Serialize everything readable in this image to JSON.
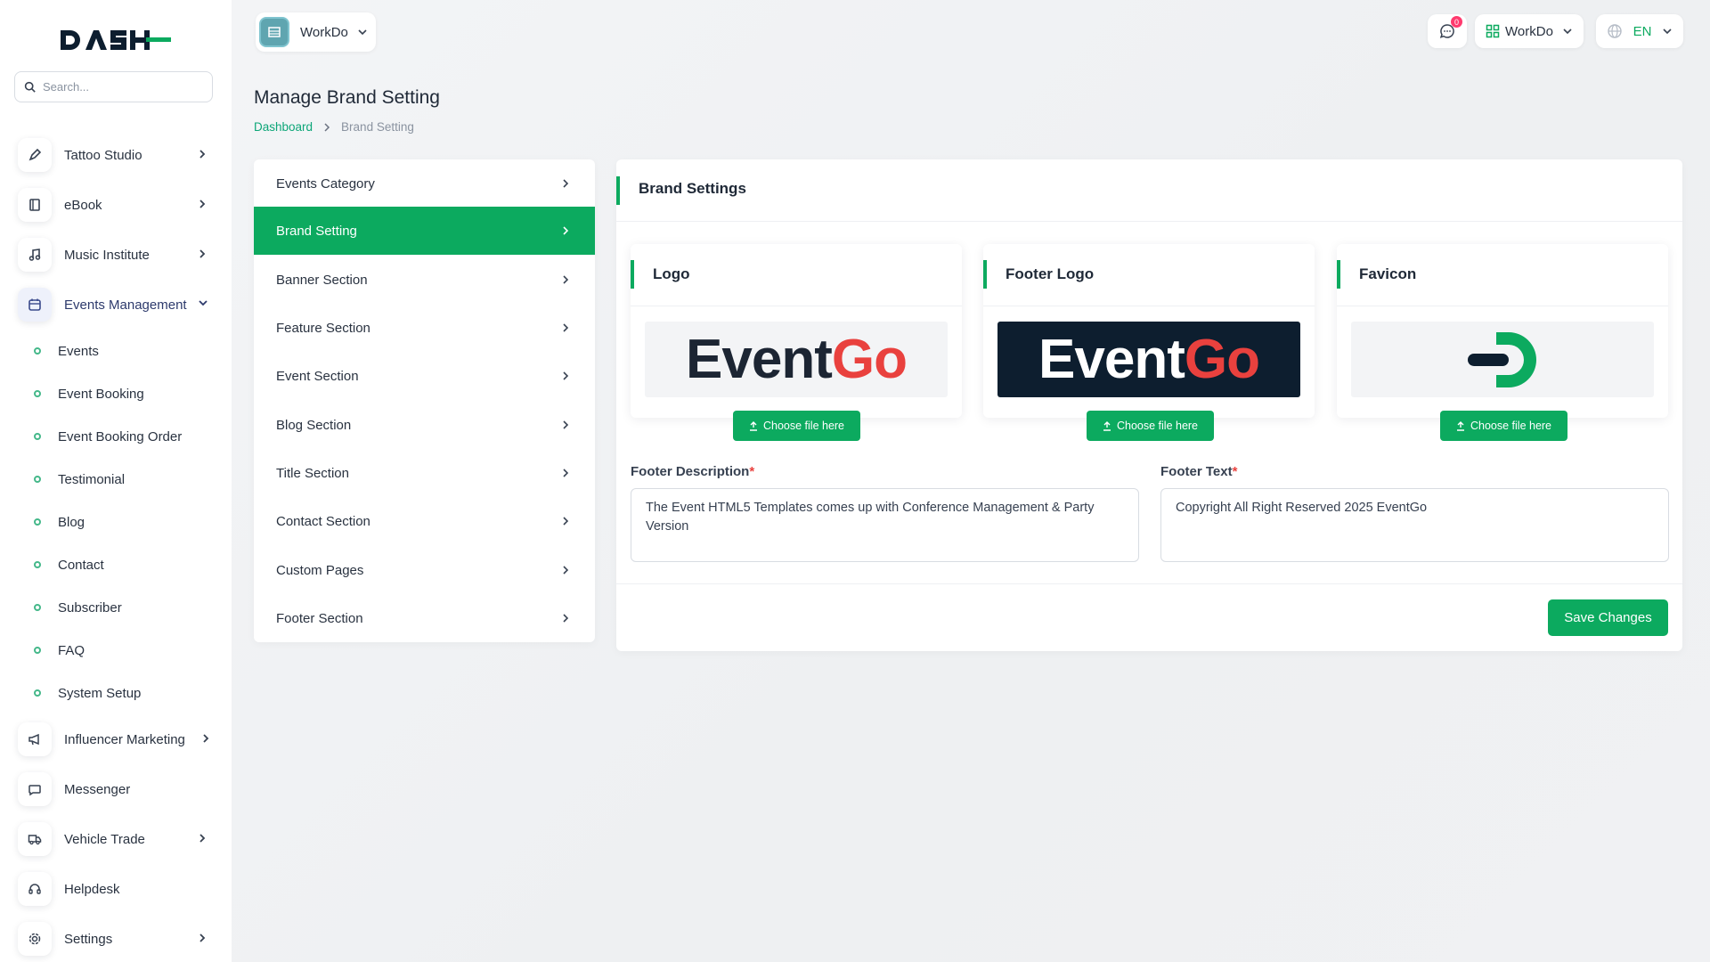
{
  "brand": {
    "logo_text": "DASH",
    "accent": "#0caa5f"
  },
  "search": {
    "placeholder": "Search..."
  },
  "sidebar": {
    "items": [
      {
        "label": "Tattoo Studio"
      },
      {
        "label": "eBook"
      },
      {
        "label": "Music Institute"
      },
      {
        "label": "Events Management"
      },
      {
        "label": "Influencer Marketing"
      },
      {
        "label": "Messenger"
      },
      {
        "label": "Vehicle Trade"
      },
      {
        "label": "Helpdesk"
      },
      {
        "label": "Settings"
      }
    ],
    "sub_items": [
      {
        "label": "Events"
      },
      {
        "label": "Event Booking"
      },
      {
        "label": "Event Booking Order"
      },
      {
        "label": "Testimonial"
      },
      {
        "label": "Blog"
      },
      {
        "label": "Contact"
      },
      {
        "label": "Subscriber"
      },
      {
        "label": "FAQ"
      },
      {
        "label": "System Setup"
      }
    ]
  },
  "topbar": {
    "workspace": "WorkDo",
    "notifications_count": "0",
    "company": "WorkDo",
    "language": "EN"
  },
  "page": {
    "title": "Manage Brand Setting",
    "breadcrumb_home": "Dashboard",
    "breadcrumb_current": "Brand Setting"
  },
  "menu": {
    "items": [
      {
        "label": "Events Category"
      },
      {
        "label": "Brand Setting"
      },
      {
        "label": "Banner Section"
      },
      {
        "label": "Feature Section"
      },
      {
        "label": "Event Section"
      },
      {
        "label": "Blog Section"
      },
      {
        "label": "Title Section"
      },
      {
        "label": "Contact Section"
      },
      {
        "label": "Custom Pages"
      },
      {
        "label": "Footer Section"
      }
    ],
    "active": "Brand Setting"
  },
  "brand_settings": {
    "title": "Brand Settings",
    "logo_title": "Logo",
    "footer_logo_title": "Footer Logo",
    "favicon_title": "Favicon",
    "logo_word_1": "Event",
    "logo_word_2": "Go",
    "choose_file": "Choose file here",
    "footer_description_label": "Footer Description",
    "footer_description_value": "The Event HTML5 Templates comes up with Conference Management & Party Version",
    "footer_text_label": "Footer Text",
    "footer_text_value": "Copyright All Right Reserved 2025 EventGo",
    "required_mark": "*",
    "save_label": "Save Changes"
  }
}
